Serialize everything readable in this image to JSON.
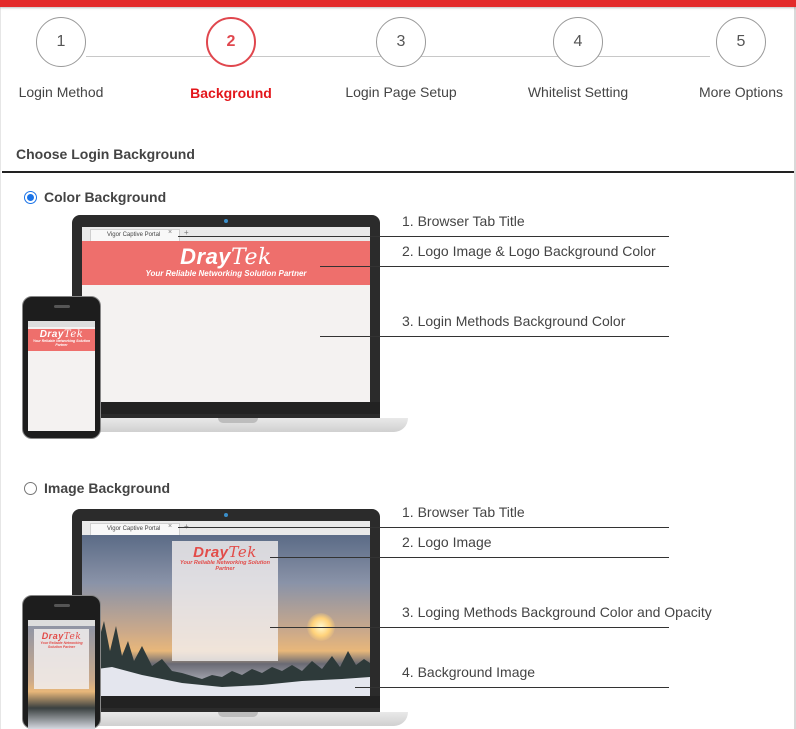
{
  "steps": [
    {
      "number": "1",
      "label": "Login Method",
      "active": false
    },
    {
      "number": "2",
      "label": "Background",
      "active": true
    },
    {
      "number": "3",
      "label": "Login Page Setup",
      "active": false
    },
    {
      "number": "4",
      "label": "Whitelist Setting",
      "active": false
    },
    {
      "number": "5",
      "label": "More Options",
      "active": false
    }
  ],
  "section": {
    "title": "Choose Login Background"
  },
  "options": {
    "color": {
      "label": "Color Background",
      "selected": true,
      "preview": {
        "tab_title": "Vigor Captive Portal",
        "logo_main": "Dray",
        "logo_tail": "Tek",
        "slogan": "Your Reliable Networking Solution Partner"
      },
      "callouts": [
        "1. Browser Tab Title",
        "2. Logo Image & Logo Background Color",
        "3. Login Methods Background Color"
      ]
    },
    "image": {
      "label": "Image Background",
      "selected": false,
      "preview": {
        "tab_title": "Vigor Captive Portal",
        "logo_main": "Dray",
        "logo_tail": "Tek",
        "slogan": "Your Reliable Networking Solution Partner"
      },
      "callouts": [
        "1. Browser Tab Title",
        "2. Logo Image",
        "3. Loging Methods Background Color and Opacity",
        "4. Background Image"
      ]
    }
  },
  "colors": {
    "accent": "#e3161b",
    "active_step_ring": "#e0474e",
    "logo_band": "#ee6f6c",
    "radio_selected": "#1a73e8"
  }
}
